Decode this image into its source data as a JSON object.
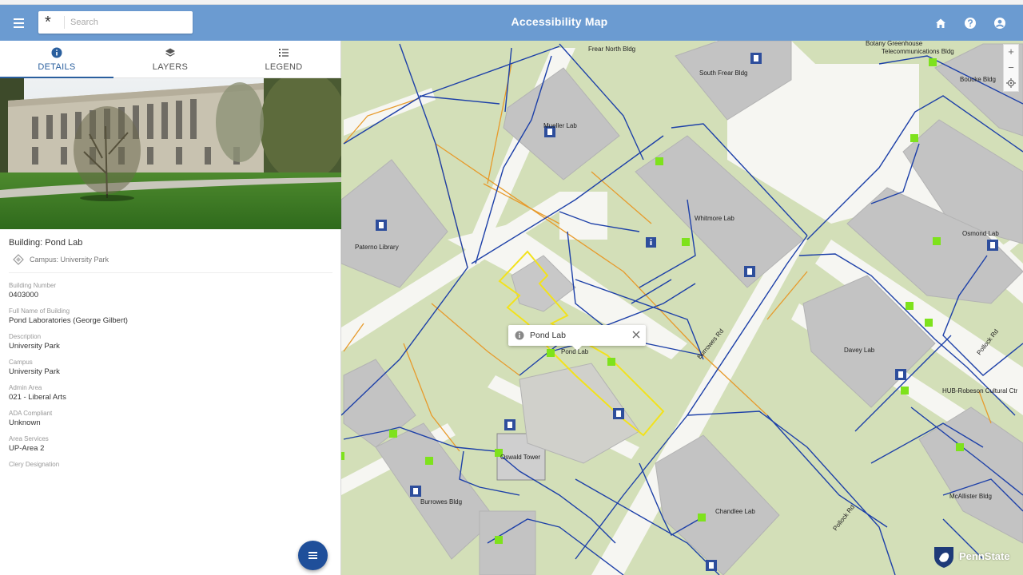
{
  "header": {
    "title": "Accessibility Map",
    "search_placeholder": "Search",
    "icons": [
      "menu-icon",
      "asterisk-icon",
      "home-icon",
      "help-icon",
      "account-icon"
    ]
  },
  "tabs": [
    {
      "label": "DETAILS",
      "icon": "info-icon",
      "active": true
    },
    {
      "label": "LAYERS",
      "icon": "layers-icon",
      "active": false
    },
    {
      "label": "LEGEND",
      "icon": "list-icon",
      "active": false
    }
  ],
  "details": {
    "building": "Building: Pond Lab",
    "campus": "Campus: University Park",
    "fields": [
      {
        "label": "Building Number",
        "value": "0403000"
      },
      {
        "label": "Full Name of Building",
        "value": "Pond Laboratories (George Gilbert)"
      },
      {
        "label": "Description",
        "value": "University Park"
      },
      {
        "label": "Campus",
        "value": "University Park"
      },
      {
        "label": "Admin Area",
        "value": "021 - Liberal Arts"
      },
      {
        "label": "ADA Compliant",
        "value": "Unknown"
      },
      {
        "label": "Area Services",
        "value": "UP-Area 2"
      },
      {
        "label": "Clery Designation",
        "value": ""
      }
    ]
  },
  "map": {
    "popup_title": "Pond Lab",
    "zoom_in": "+",
    "zoom_out": "−",
    "brand": "PennState",
    "labels": {
      "frear_north": "Frear North Bldg",
      "botany": "Botany Greenhouse",
      "telecom": "Telecommunications Bldg",
      "south_frear": "South Frear Bldg",
      "boucke": "Boucke Bldg",
      "mueller": "Mueller Lab",
      "whitmore": "Whitmore Lab",
      "osmond": "Osmond Lab",
      "paterno": "Paterno Library",
      "pond": "Pond Lab",
      "burrowes_road": "Burrowes Rd",
      "davey": "Davey Lab",
      "pollock_road": "Pollock Rd",
      "hub": "HUB-Robeson Cultural Ctr",
      "oswald": "Oswald Tower",
      "burrowes_bldg": "Burrowes Bldg",
      "chandlee": "Chandlee Lab",
      "mcallister": "McAllister Bldg",
      "pollock_road_2": "Pollock Rd"
    },
    "colors": {
      "ground": "#d3dfb8",
      "building": "#c3c3c3",
      "walkway": "#f6f6f2",
      "accessible_route": "#1d40a8",
      "alt_route": "#e79a2b",
      "selected": "#f2e21c",
      "entrance": "#7ee21c",
      "parking": "#2e4e9c"
    }
  }
}
